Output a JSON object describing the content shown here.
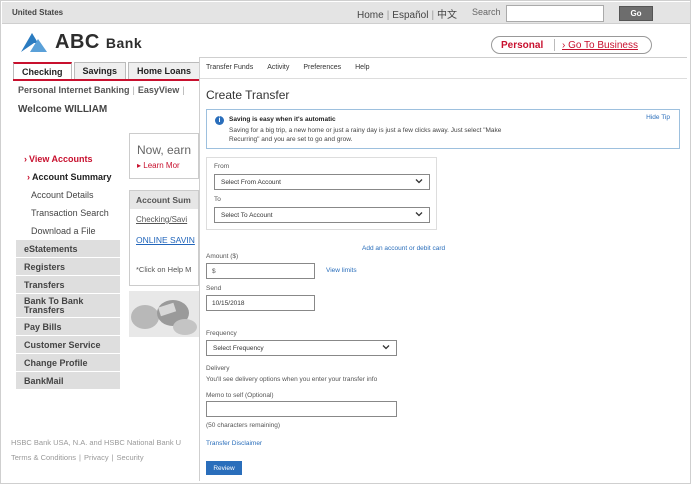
{
  "header": {
    "region": "United States",
    "links": [
      "Home",
      "Español",
      "中文"
    ],
    "search_label": "Search",
    "search_value": "",
    "go_label": "Go"
  },
  "brand": {
    "name": "ABC",
    "suffix": "Bank",
    "accent": "#c8102e",
    "logo_color": "#2a7bc0"
  },
  "segment": {
    "personal": "Personal",
    "business": "› Go To Business"
  },
  "nav_tabs": [
    "Checking",
    "Savings",
    "Home Loans"
  ],
  "subnav": [
    "Personal Internet Banking",
    "EasyView",
    ""
  ],
  "welcome": "Welcome WILLIAM",
  "sidebar": {
    "view_accounts": "View Accounts",
    "account_summary": "Account Summary",
    "account_details": "Account Details",
    "transaction_search": "Transaction Search",
    "download_file": "Download a File",
    "estatements": "eStatements",
    "registers": "Registers",
    "transfers": "Transfers",
    "bank_to_bank_1": "Bank To Bank",
    "bank_to_bank_2": "Transfers",
    "pay_bills": "Pay Bills",
    "customer_service": "Customer Service",
    "change_profile": "Change Profile",
    "bankmail": "BankMail"
  },
  "promo": {
    "title": "Now, earn",
    "link": "Learn Mor"
  },
  "account_box": {
    "heading": "Account Sum",
    "link1": "Checking/Savi",
    "link2": "ONLINE SAVIN",
    "note": "*Click on Help M"
  },
  "footer": {
    "text": "HSBC Bank USA, N.A. and HSBC National Bank U",
    "links": [
      "Terms & Conditions",
      "Privacy",
      "Security"
    ]
  },
  "panel": {
    "tabs": [
      "Transfer Funds",
      "Activity",
      "Preferences",
      "Help"
    ],
    "title": "Create Transfer",
    "tip": {
      "title": "Saving is easy when it's automatic",
      "body": "Saving for a big trip, a new home or just a rainy day is just a few clicks away. Just select \"Make Recurring\" and you are set to go and grow.",
      "hide": "Hide Tip"
    },
    "from_label": "From",
    "from_value": "Select From Account",
    "to_label": "To",
    "to_value": "Select To Account",
    "add_account": "Add an account or debit card",
    "amount_label": "Amount ($)",
    "amount_value": "$",
    "view_limits": "View limits",
    "send_label": "Send",
    "send_value": "10/15/2018",
    "frequency_label": "Frequency",
    "frequency_value": "Select Frequency",
    "delivery_label": "Delivery",
    "delivery_text": "You'll see delivery options when you enter your transfer info",
    "memo_label": "Memo to self (Optional)",
    "memo_value": "",
    "memo_remaining": "(50 characters remaining)",
    "disclaimer": "Transfer Disclaimer",
    "review": "Review"
  }
}
